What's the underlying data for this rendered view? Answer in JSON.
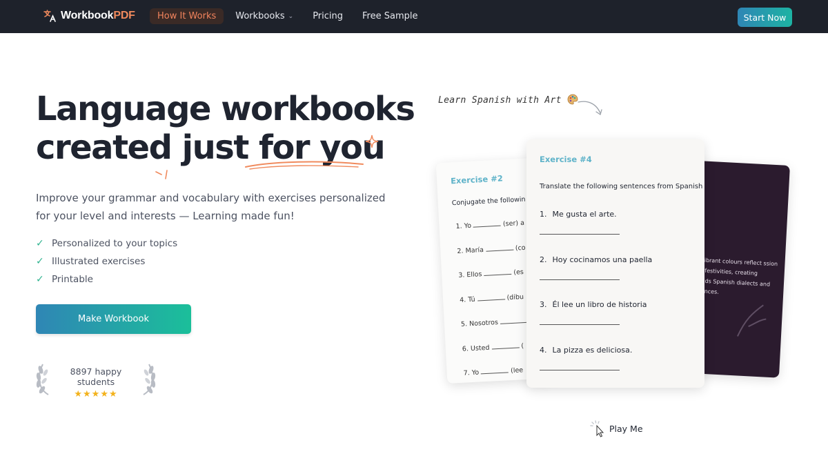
{
  "nav": {
    "brand_main": "Workbook",
    "brand_accent": "PDF",
    "links": [
      {
        "label": "How It Works",
        "active": true
      },
      {
        "label": "Workbooks",
        "dropdown": true
      },
      {
        "label": "Pricing"
      },
      {
        "label": "Free Sample"
      }
    ],
    "cta": "Start Now"
  },
  "hero": {
    "title_line1": "Language workbooks",
    "title_line2": "created just for you",
    "subtitle": "Improve your grammar and vocabulary with exercises personalized for your level and interests — Learning made fun!",
    "features": [
      "Personalized to your topics",
      "Illustrated exercises",
      "Printable"
    ],
    "button": "Make Workbook",
    "students": "8897 happy students",
    "rating": 5,
    "stars": "★★★★★"
  },
  "showcase": {
    "label": "Learn Spanish with Art",
    "card_back_left": {
      "title": "Exercise #2",
      "instruction": "Conjugate the followin",
      "items": [
        {
          "n": "1.",
          "subject": "Yo",
          "hint": "(ser) a"
        },
        {
          "n": "2.",
          "subject": "María",
          "hint": "(co"
        },
        {
          "n": "3.",
          "subject": "Ellos",
          "hint": "(es"
        },
        {
          "n": "4.",
          "subject": "Tú",
          "hint": "(dibu"
        },
        {
          "n": "5.",
          "subject": "Nosotros",
          "hint": ""
        },
        {
          "n": "6.",
          "subject": "Usted",
          "hint": "("
        },
        {
          "n": "7.",
          "subject": "Yo",
          "hint": "(lee"
        }
      ]
    },
    "card_front": {
      "title": "Exercise #4",
      "instruction": "Translate the following sentences from Spanish",
      "items": [
        {
          "n": "1.",
          "text": "Me gusta el arte."
        },
        {
          "n": "2.",
          "text": "Hoy cocinamos una paella"
        },
        {
          "n": "3.",
          "text": "Él lee un libro de historia"
        },
        {
          "n": "4.",
          "text": "La pizza es deliciosa."
        }
      ]
    },
    "card_back_right": {
      "text": "rt, vibrant colours reflect ssion and festivities, creating scends Spanish dialects and fferences."
    },
    "play": "Play Me"
  },
  "colors": {
    "nav_bg": "#1e222b",
    "accent_orange": "#f08a5d",
    "teal": "#1db3a3",
    "blue": "#2f86b5",
    "exercise_title": "#5fb3c9",
    "star": "#f3b21c"
  }
}
